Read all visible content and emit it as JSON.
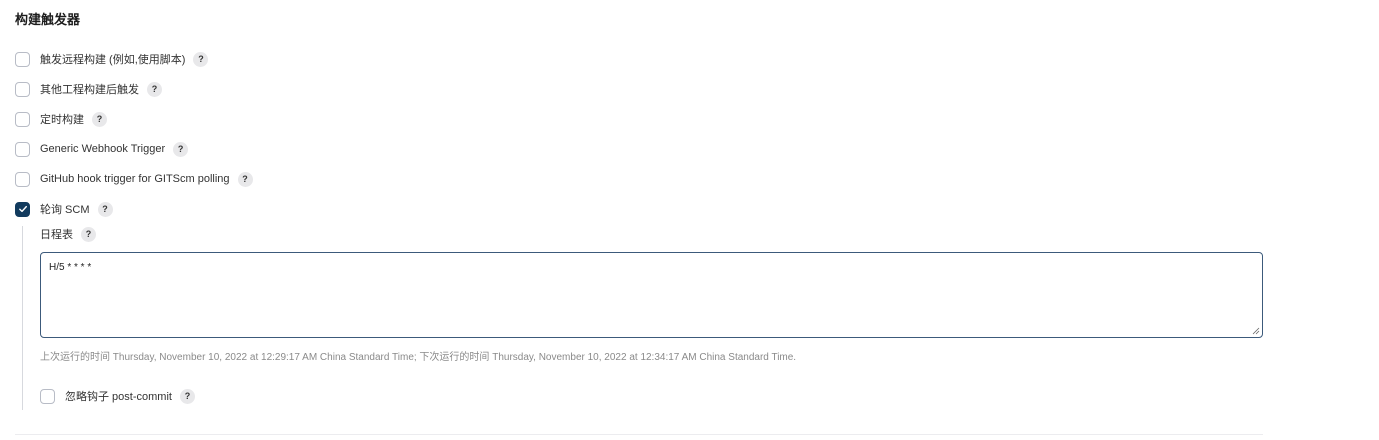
{
  "section": {
    "title": "构建触发器"
  },
  "triggers": [
    {
      "label": "触发远程构建 (例如,使用脚本)",
      "checked": false
    },
    {
      "label": "其他工程构建后触发",
      "checked": false
    },
    {
      "label": "定时构建",
      "checked": false
    },
    {
      "label": "Generic Webhook Trigger",
      "checked": false
    },
    {
      "label": "GitHub hook trigger for GITScm polling",
      "checked": false
    },
    {
      "label": "轮询 SCM",
      "checked": true
    }
  ],
  "help_glyph": "?",
  "poll_scm": {
    "schedule_label": "日程表",
    "schedule_value": "H/5 * * * *",
    "run_info": "上次运行的时间 Thursday, November 10, 2022 at 12:29:17 AM China Standard Time; 下次运行的时间 Thursday, November 10, 2022 at 12:34:17 AM China Standard Time.",
    "ignore_hooks_label": "忽略钩子 post-commit",
    "ignore_hooks_checked": false
  },
  "colors": {
    "checked_accent": "#123b5e",
    "textarea_border": "#3c5a7b"
  }
}
